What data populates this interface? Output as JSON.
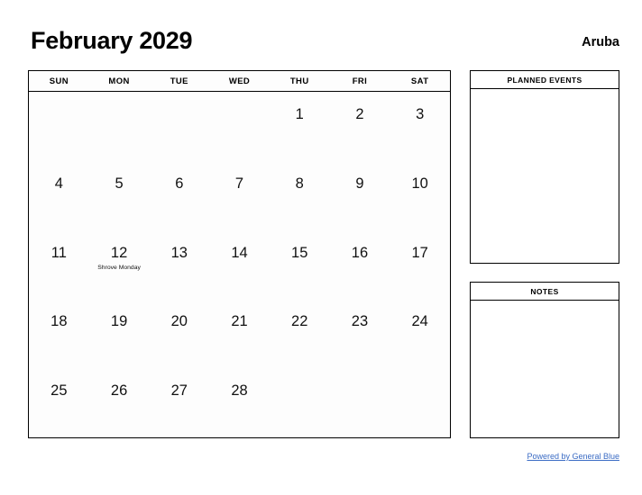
{
  "header": {
    "month_title": "February 2029",
    "country": "Aruba"
  },
  "calendar": {
    "weekdays": [
      "SUN",
      "MON",
      "TUE",
      "WED",
      "THU",
      "FRI",
      "SAT"
    ],
    "weeks": [
      [
        {
          "day": "",
          "event": ""
        },
        {
          "day": "",
          "event": ""
        },
        {
          "day": "",
          "event": ""
        },
        {
          "day": "",
          "event": ""
        },
        {
          "day": "1",
          "event": ""
        },
        {
          "day": "2",
          "event": ""
        },
        {
          "day": "3",
          "event": ""
        }
      ],
      [
        {
          "day": "4",
          "event": ""
        },
        {
          "day": "5",
          "event": ""
        },
        {
          "day": "6",
          "event": ""
        },
        {
          "day": "7",
          "event": ""
        },
        {
          "day": "8",
          "event": ""
        },
        {
          "day": "9",
          "event": ""
        },
        {
          "day": "10",
          "event": ""
        }
      ],
      [
        {
          "day": "11",
          "event": ""
        },
        {
          "day": "12",
          "event": "Shrove Monday"
        },
        {
          "day": "13",
          "event": ""
        },
        {
          "day": "14",
          "event": ""
        },
        {
          "day": "15",
          "event": ""
        },
        {
          "day": "16",
          "event": ""
        },
        {
          "day": "17",
          "event": ""
        }
      ],
      [
        {
          "day": "18",
          "event": ""
        },
        {
          "day": "19",
          "event": ""
        },
        {
          "day": "20",
          "event": ""
        },
        {
          "day": "21",
          "event": ""
        },
        {
          "day": "22",
          "event": ""
        },
        {
          "day": "23",
          "event": ""
        },
        {
          "day": "24",
          "event": ""
        }
      ],
      [
        {
          "day": "25",
          "event": ""
        },
        {
          "day": "26",
          "event": ""
        },
        {
          "day": "27",
          "event": ""
        },
        {
          "day": "28",
          "event": ""
        },
        {
          "day": "",
          "event": ""
        },
        {
          "day": "",
          "event": ""
        },
        {
          "day": "",
          "event": ""
        }
      ]
    ]
  },
  "panels": {
    "planned_events": {
      "title": "PLANNED EVENTS",
      "content": ""
    },
    "notes": {
      "title": "NOTES",
      "content": ""
    }
  },
  "footer": {
    "powered_by": "Powered by General Blue"
  },
  "colors": {
    "link": "#3a6bc4",
    "border": "#000000",
    "text": "#111111",
    "page_background": "#ffffff",
    "grid_background": "#fdfdfd"
  }
}
